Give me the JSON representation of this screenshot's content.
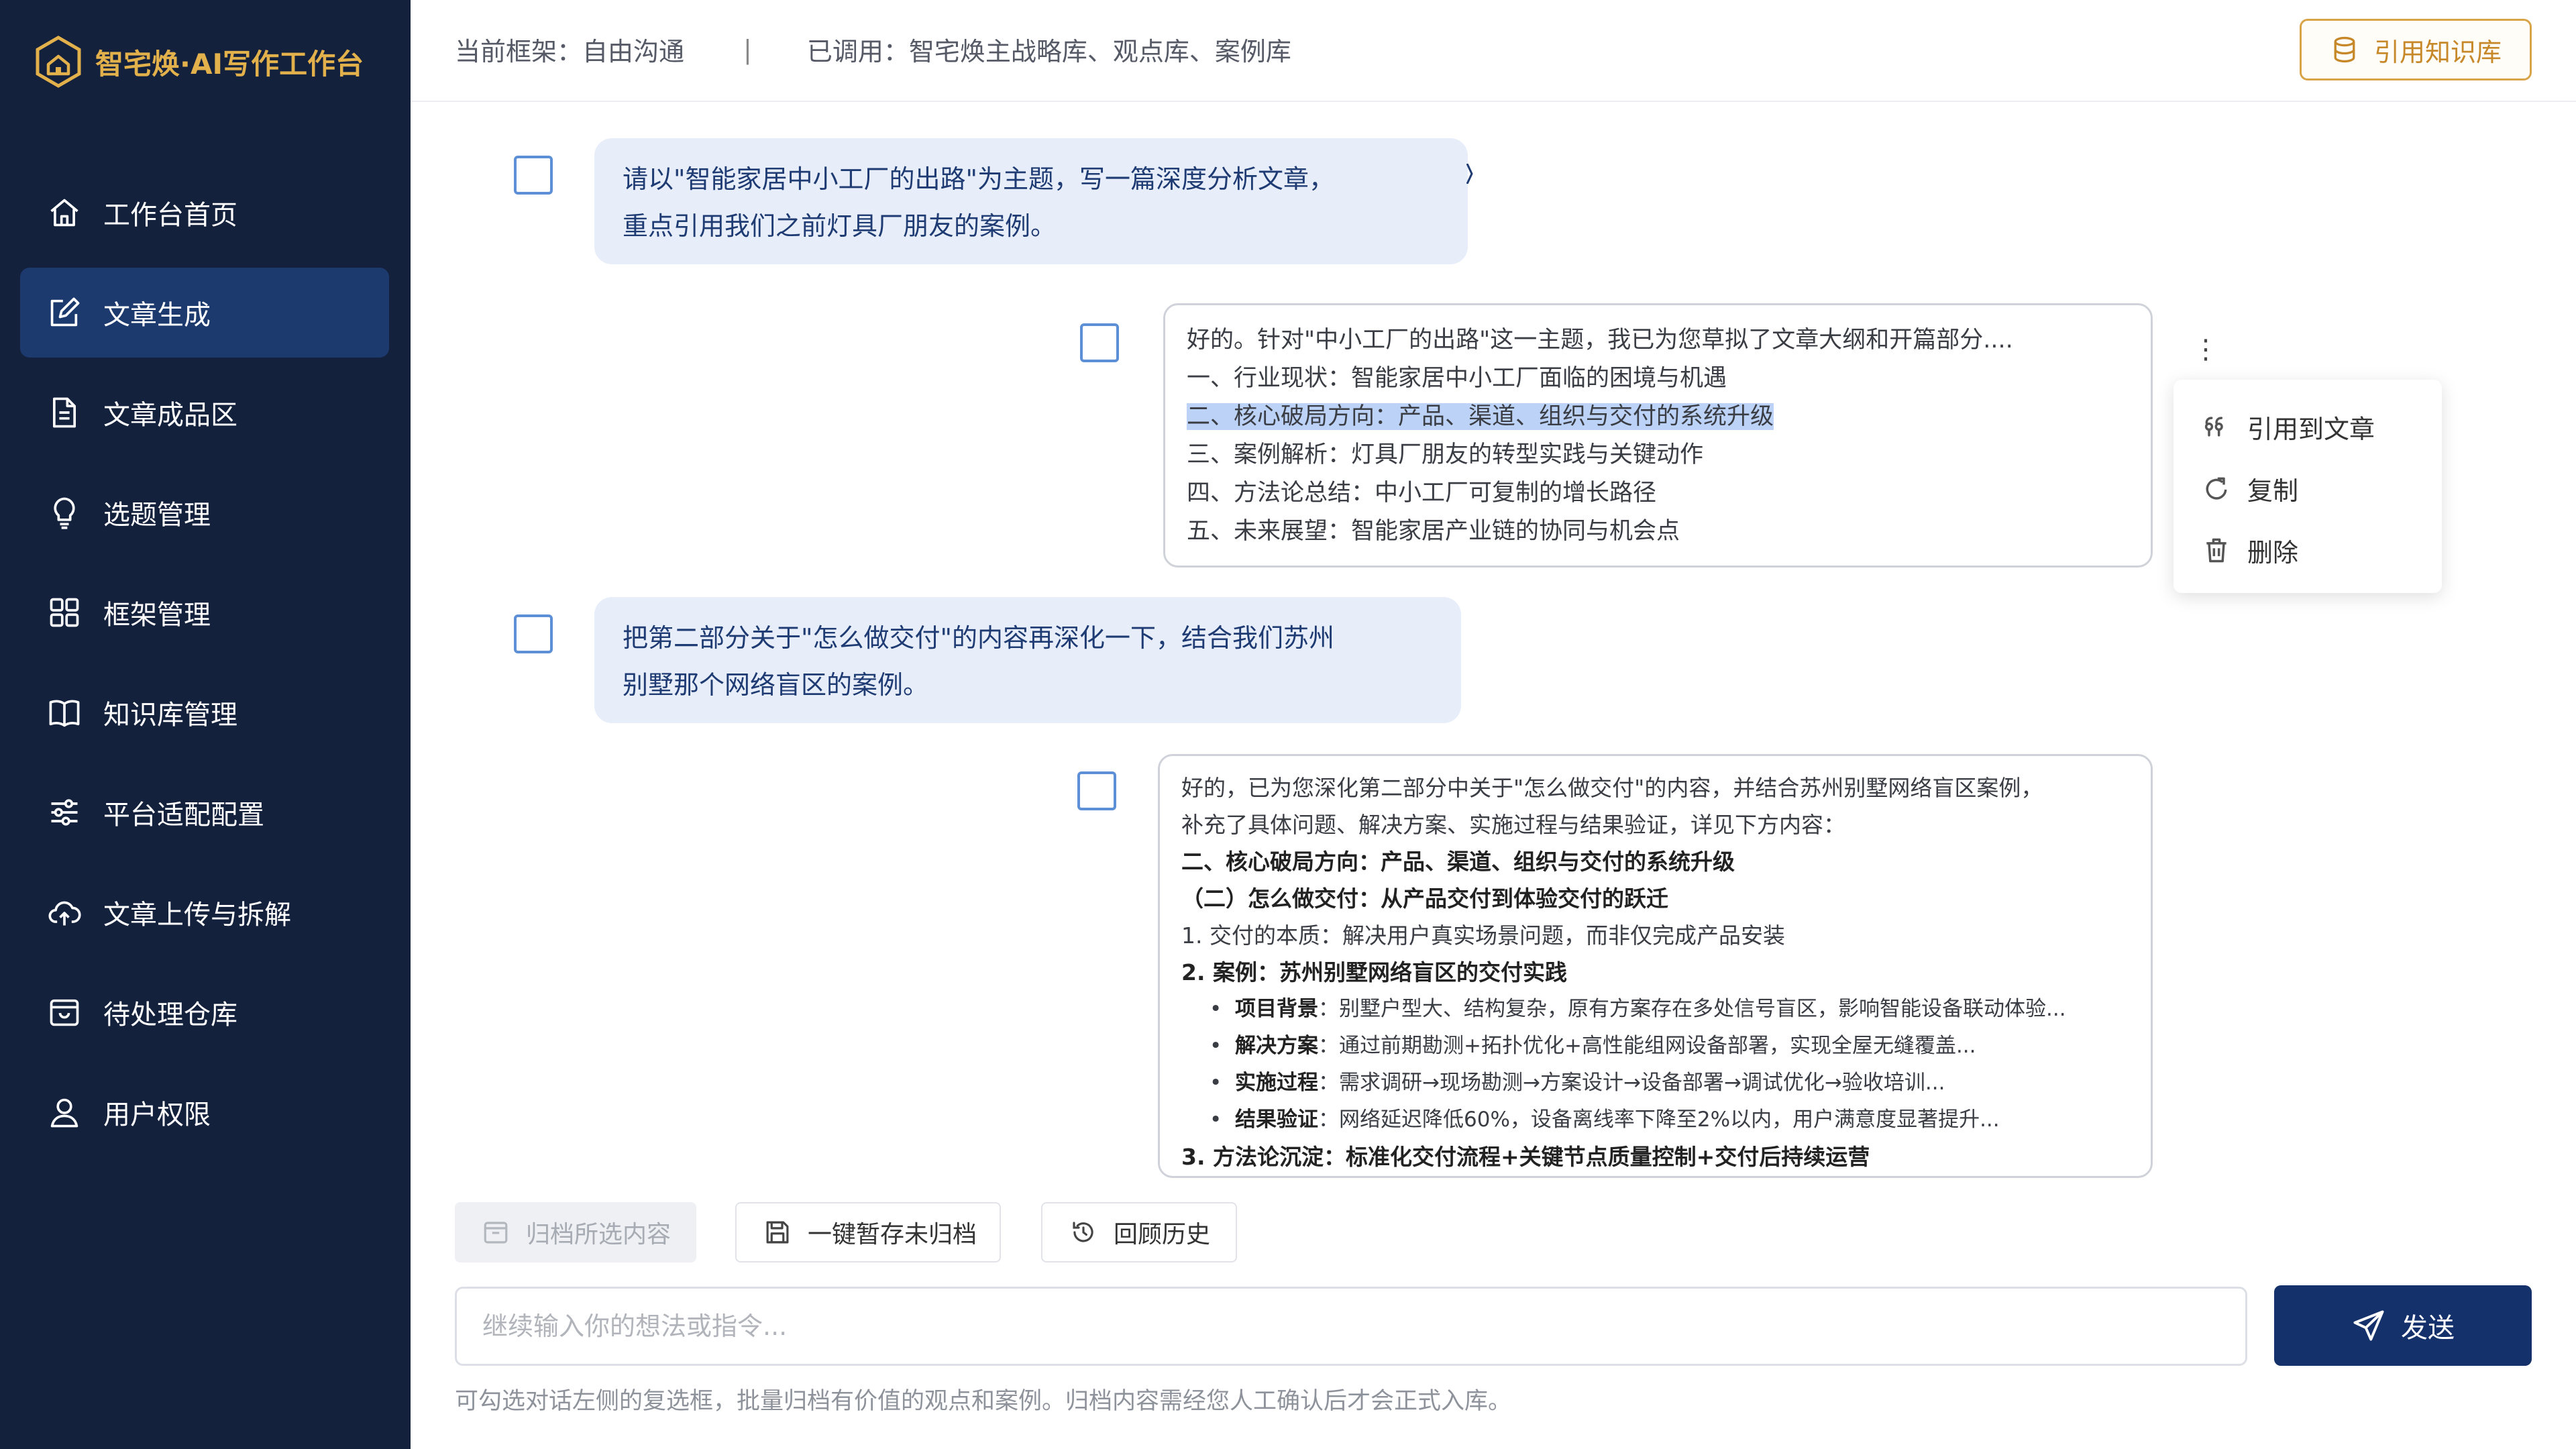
{
  "brand": {
    "title": "智宅焕·AI写作工作台",
    "color": "#e2b14c"
  },
  "sidebar": {
    "items": [
      {
        "label": "工作台首页",
        "icon": "home-icon",
        "active": false
      },
      {
        "label": "文章生成",
        "icon": "edit-icon",
        "active": true
      },
      {
        "label": "文章成品区",
        "icon": "document-icon",
        "active": false
      },
      {
        "label": "选题管理",
        "icon": "lightbulb-icon",
        "active": false
      },
      {
        "label": "框架管理",
        "icon": "grid-icon",
        "active": false
      },
      {
        "label": "知识库管理",
        "icon": "book-icon",
        "active": false
      },
      {
        "label": "平台适配配置",
        "icon": "sliders-icon",
        "active": false
      },
      {
        "label": "文章上传与拆解",
        "icon": "cloud-upload-icon",
        "active": false
      },
      {
        "label": "待处理仓库",
        "icon": "inbox-icon",
        "active": false
      },
      {
        "label": "用户权限",
        "icon": "user-icon",
        "active": false
      }
    ]
  },
  "topbar": {
    "frame_label": "当前框架：",
    "frame_value": "自由沟通",
    "separator": "|",
    "used_label": "已调用：",
    "used_value": "智宅焕主战略库、观点库、案例库",
    "kb_button": "引用知识库"
  },
  "chat": {
    "m1": {
      "line1": "请以\"智能家居中小工厂的出路\"为主题，写一篇深度分析文章，",
      "line2": "重点引用我们之前灯具厂朋友的案例。"
    },
    "m2": {
      "intro": "好的。针对\"中小工厂的出路\"这一主题，我已为您草拟了文章大纲和开篇部分....",
      "l1": "一、行业现状：智能家居中小工厂面临的困境与机遇",
      "l2": "二、核心破局方向：产品、渠道、组织与交付的系统升级",
      "l3": "三、案例解析：灯具厂朋友的转型实践与关键动作",
      "l4": "四、方法论总结：中小工厂可复制的增长路径",
      "l5": "五、未来展望：智能家居产业链的协同与机会点"
    },
    "m3": {
      "line1": "把第二部分关于\"怎么做交付\"的内容再深化一下，结合我们苏州",
      "line2": "别墅那个网络盲区的案例。"
    },
    "m4": {
      "l1": "好的，已为您深化第二部分中关于\"怎么做交付\"的内容，并结合苏州别墅网络盲区案例，",
      "l2": "补充了具体问题、解决方案、实施过程与结果验证，详见下方内容：",
      "l3": "二、核心破局方向：产品、渠道、组织与交付的系统升级",
      "l4": "（二）怎么做交付：从产品交付到体验交付的跃迁",
      "l5": "1. 交付的本质：解决用户真实场景问题，而非仅完成产品安装",
      "l6": "2. 案例：苏州别墅网络盲区的交付实践",
      "b1_label": "项目背景",
      "b1_text": "：别墅户型大、结构复杂，原有方案存在多处信号盲区，影响智能设备联动体验...",
      "b2_label": "解决方案",
      "b2_text": "：通过前期勘测+拓扑优化+高性能组网设备部署，实现全屋无缝覆盖...",
      "b3_label": "实施过程",
      "b3_text": "：需求调研→现场勘测→方案设计→设备部署→调试优化→验收培训...",
      "b4_label": "结果验证",
      "b4_text": "：网络延迟降低60%，设备离线率下降至2%以内，用户满意度显著提升...",
      "l7": "3. 方法论沉淀：标准化交付流程+关键节点质量控制+交付后持续运营"
    }
  },
  "context_menu": {
    "dots": "⋮",
    "items": [
      {
        "label": "引用到文章",
        "icon": "quote-icon"
      },
      {
        "label": "复制",
        "icon": "copy-icon"
      },
      {
        "label": "删除",
        "icon": "trash-icon"
      }
    ]
  },
  "actions": {
    "archive": "归档所选内容",
    "save": "一键暂存未归档",
    "history": "回顾历史"
  },
  "composer": {
    "placeholder": "继续输入你的想法或指令...",
    "value": "",
    "send": "发送"
  },
  "hint": "可勾选对话左侧的复选框，批量归档有价值的观点和案例。归档内容需经您人工确认后才会正式入库。",
  "colors": {
    "sidebar_bg": "#14213d",
    "sidebar_active": "#1c3a6e",
    "accent_gold": "#d9a448",
    "user_bubble": "#e7eef9",
    "send_button": "#14316b",
    "highlight": "#bcd3f7"
  }
}
